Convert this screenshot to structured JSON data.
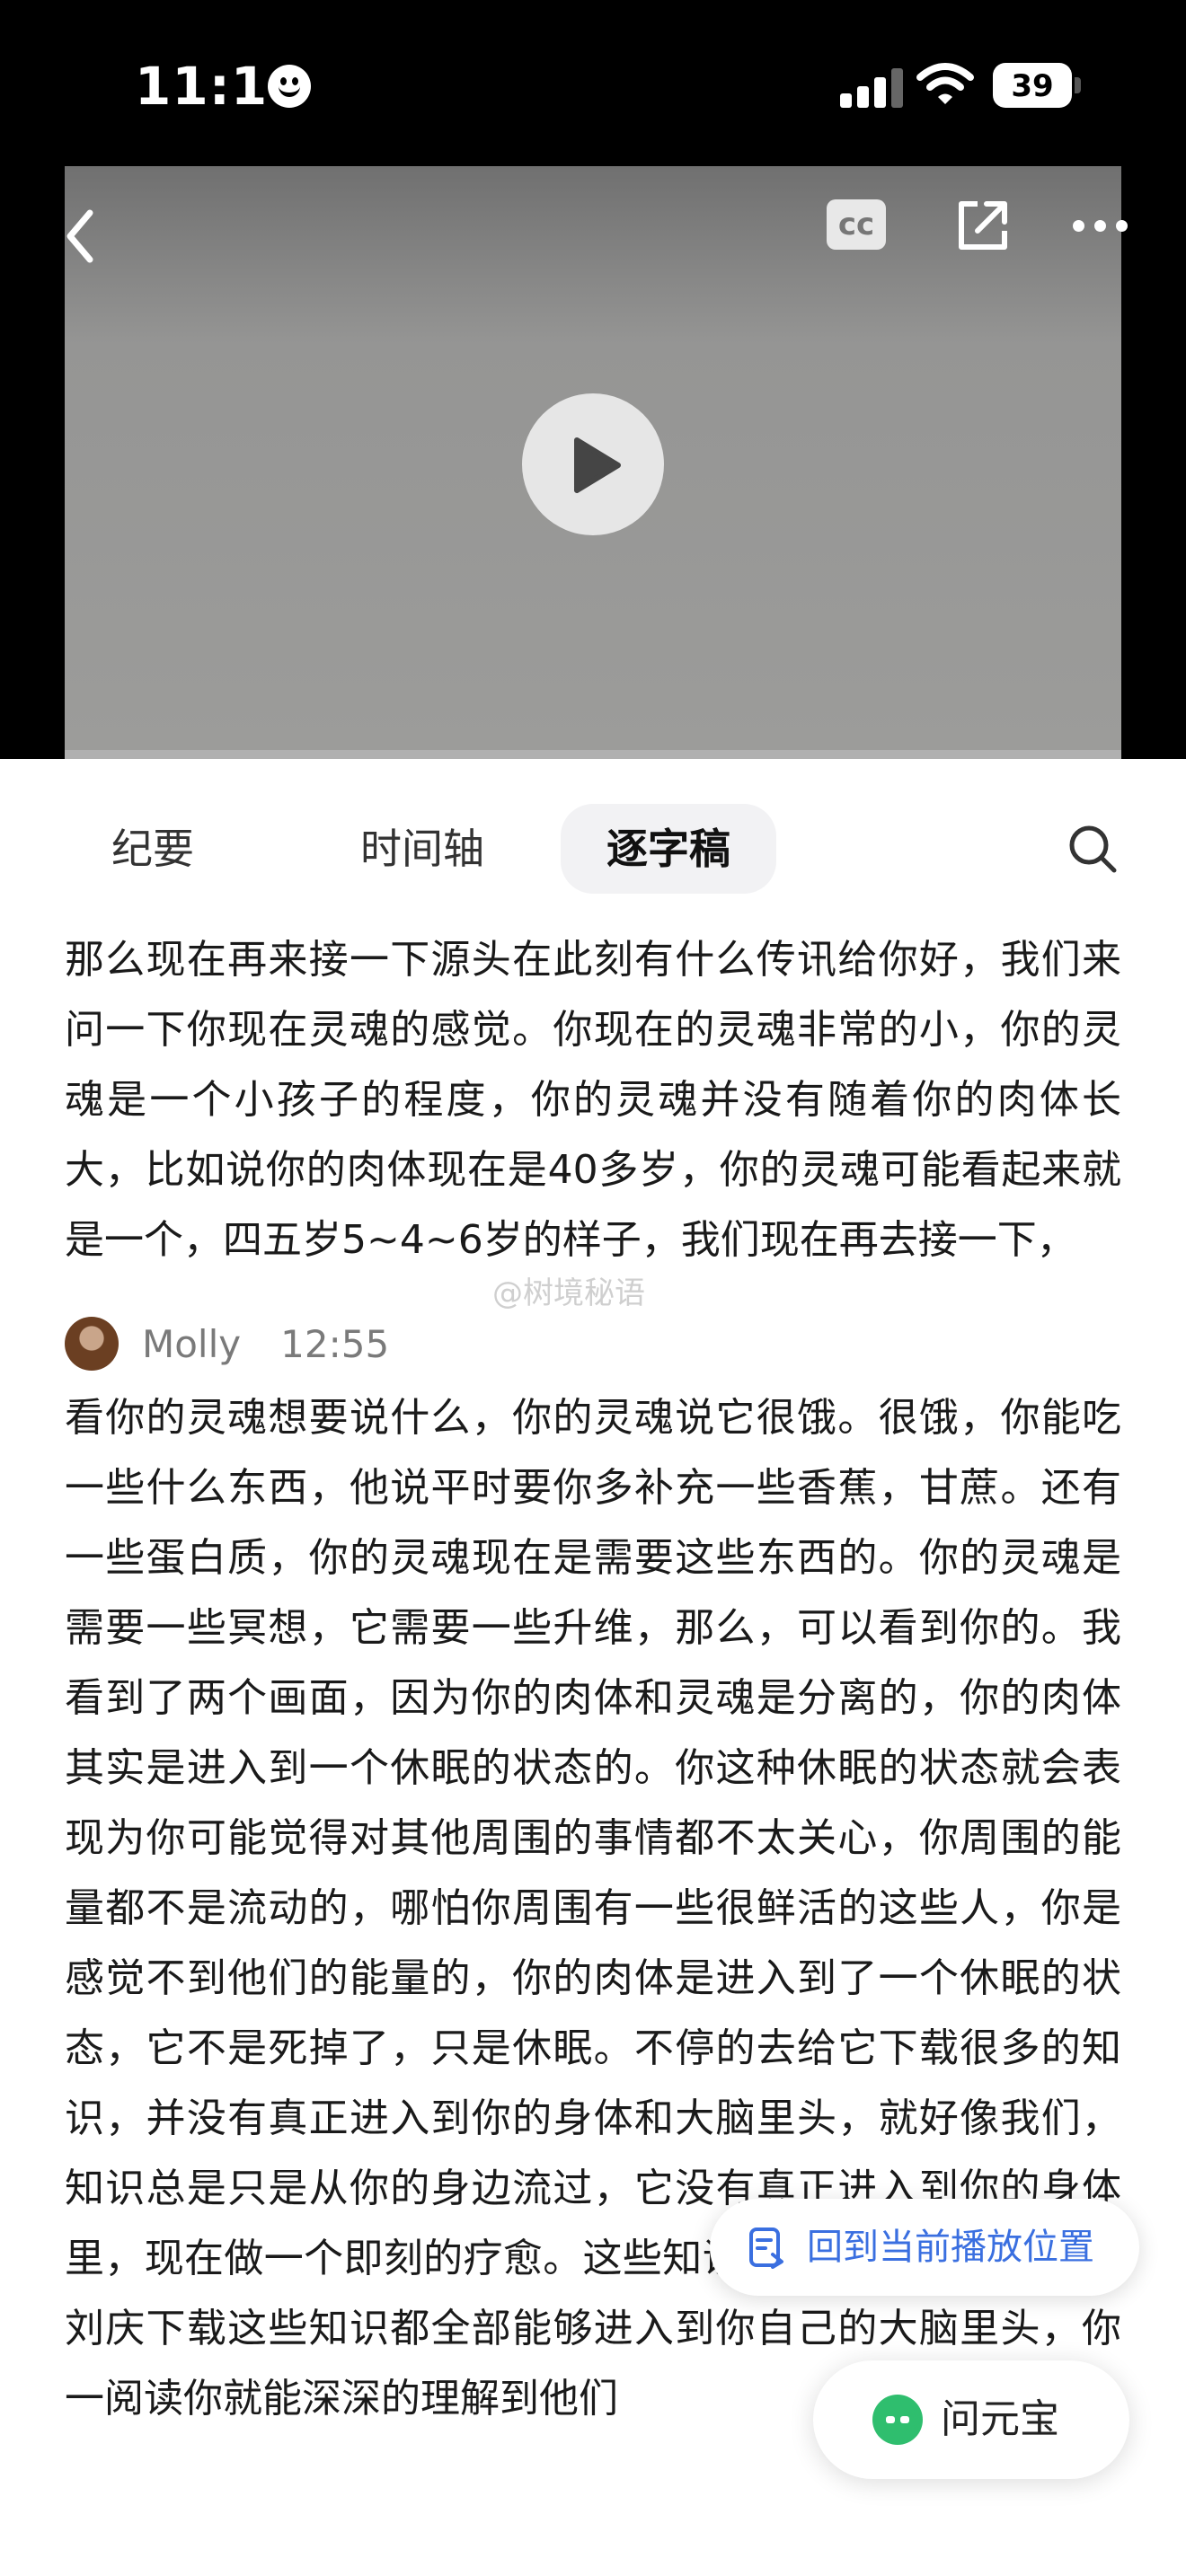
{
  "status_bar": {
    "time": "11:16",
    "battery": "39"
  },
  "tabs": [
    {
      "label": "纪要"
    },
    {
      "label": "时间轴"
    },
    {
      "label": "逐字稿"
    }
  ],
  "video": {
    "cc_label": "cc"
  },
  "transcript": {
    "paragraph1": "那么现在再来接一下源头在此刻有什么传讯给你好，我们来问一下你现在灵魂的感觉。你现在的灵魂非常的小，你的灵魂是一个小孩子的程度，你的灵魂并没有随着你的肉体长大，比如说你的肉体现在是40多岁，你的灵魂可能看起来就是一个，四五岁5~4~6岁的样子，我们现在再去接一下，",
    "speaker": {
      "name": "Molly",
      "time": "12:55"
    },
    "paragraph2": "看你的灵魂想要说什么，你的灵魂说它很饿。很饿，你能吃一些什么东西，他说平时要你多补充一些香蕉，甘蔗。还有一些蛋白质，你的灵魂现在是需要这些东西的。你的灵魂是需要一些冥想，它需要一些升维，那么，可以看到你的。我看到了两个画面，因为你的肉体和灵魂是分离的，你的肉体其实是进入到一个休眠的状态的。你这种休眠的状态就会表现为你可能觉得对其他周围的事情都不太关心，你周围的能量都不是流动的，哪怕你周围有一些很鲜活的这些人，你是感觉不到他们的能量的，你的肉体是进入到了一个休眠的状态，它不是死掉了，只是休眠。不停的去给它下载很多的知识，并没有真正进入到你的身体和大脑里头，就好像我们，知识总是只是从你的身边流过，它没有真正进入到你的身体里，现在做一个即刻的疗愈。这些知识，s。那么我们现在给刘庆下载这些知识都全部能够进入到你自己的大脑里头，你一阅读你就能深深的理解到他们"
  },
  "watermark": "@树境秘语",
  "floating": {
    "return_label": "回到当前播放位置",
    "assistant_label": "问元宝"
  }
}
